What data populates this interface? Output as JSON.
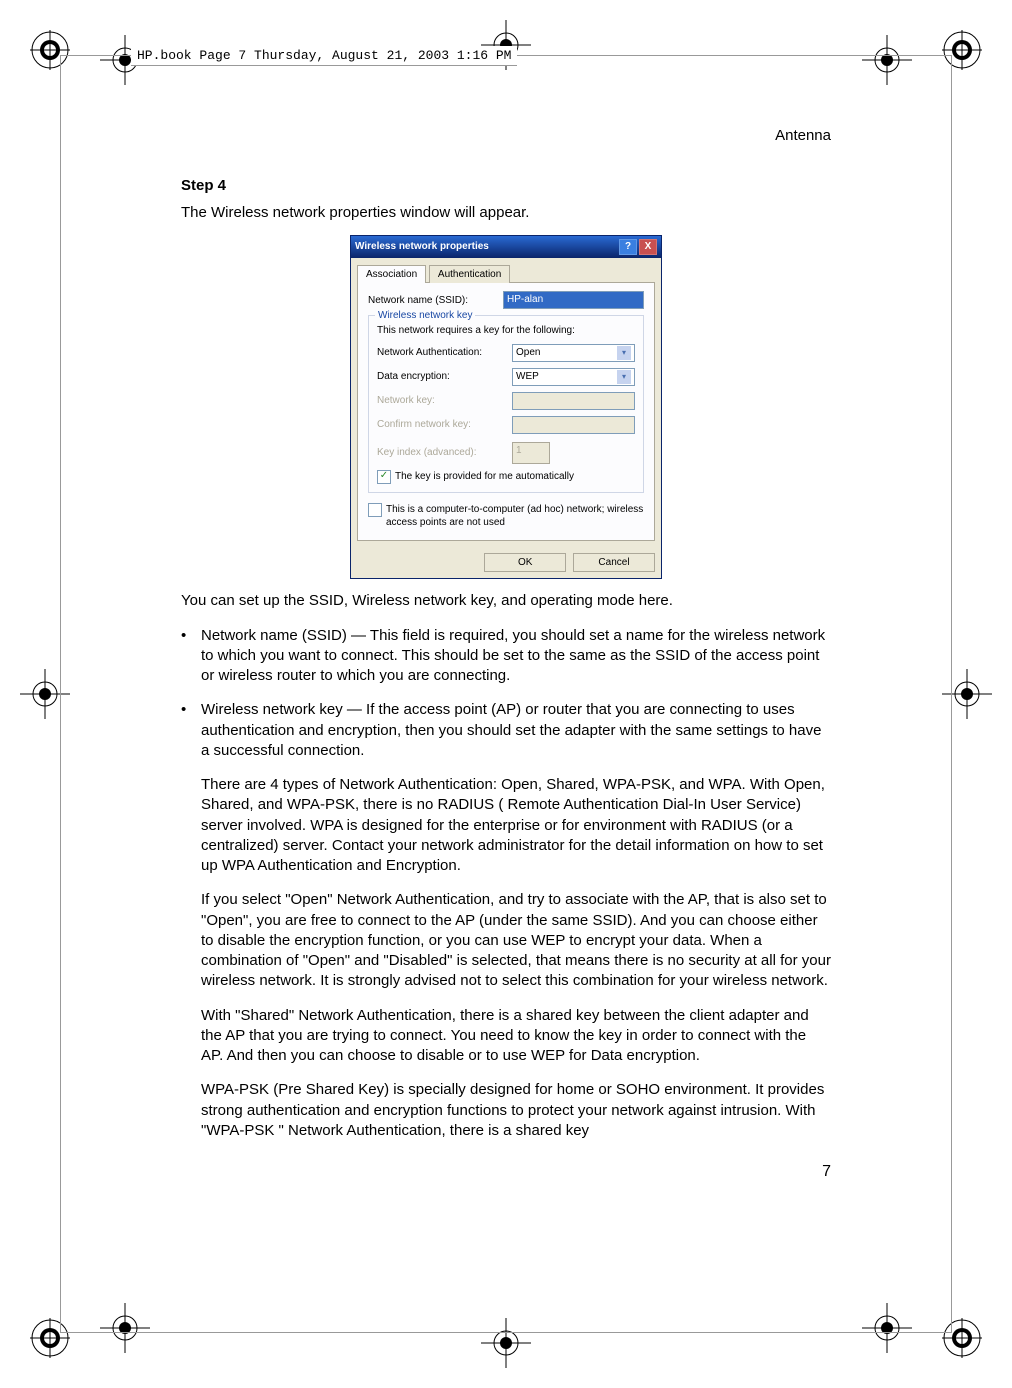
{
  "header_line": "HP.book  Page 7  Thursday, August 21, 2003  1:16 PM",
  "running_head": "Antenna",
  "step_title": "Step 4",
  "intro": "The Wireless network properties window will appear.",
  "dialog": {
    "title": "Wireless network properties",
    "help_btn": "?",
    "close_btn": "X",
    "tab_association": "Association",
    "tab_authentication": "Authentication",
    "ssid_label": "Network name (SSID):",
    "ssid_value": "HP-alan",
    "fieldset_legend": "Wireless network key",
    "fieldset_hint": "This network requires a key for the following:",
    "auth_label": "Network Authentication:",
    "auth_value": "Open",
    "enc_label": "Data encryption:",
    "enc_value": "WEP",
    "key_label": "Network key:",
    "confirm_label": "Confirm network key:",
    "keyindex_label": "Key index (advanced):",
    "keyindex_value": "1",
    "auto_label": "The key is provided for me automatically",
    "adhoc_label": "This is a computer-to-computer (ad hoc) network; wireless access points are not used",
    "ok": "OK",
    "cancel": "Cancel"
  },
  "after_dialog": "You can set up the SSID, Wireless network key, and operating mode here.",
  "bullets": [
    "Network name (SSID) — This field is required, you should set a name for the wireless network to which you want to connect. This should be set to the same as the SSID of the access point or wireless router to which you are connecting.",
    "Wireless network key — If the access point (AP) or router that you are connecting to uses authentication and encryption, then you should set the adapter with the same settings to have a successful connection."
  ],
  "paras": [
    "There are 4 types of Network Authentication: Open, Shared, WPA-PSK, and WPA. With Open, Shared, and WPA-PSK, there is no RADIUS ( Remote Authentication Dial-In User Service) server involved. WPA is designed for the enterprise or for environment with RADIUS (or a centralized) server. Contact your network administrator for the detail information on how to set up WPA Authentication and Encryption.",
    "If you select \"Open\" Network Authentication, and try to associate with the AP, that is also set to \"Open\", you are free to connect to the AP (under the same SSID). And you can choose either to disable the encryption function, or you can use WEP to encrypt your data. When a combination of \"Open\" and \"Disabled\" is selected, that means there is no security at all for your wireless network. It is strongly advised not to select this combination for your wireless network.",
    "With \"Shared\" Network Authentication, there is a shared key between the client adapter and the AP that you are trying to connect. You need to know the key in order to connect with the AP. And then you can choose to disable or to use WEP for Data encryption.",
    "WPA-PSK (Pre Shared Key) is specially designed for home or SOHO environment. It provides strong authentication and encryption functions to protect your network against intrusion. With \"WPA-PSK \" Network Authentication, there is a shared key"
  ],
  "page_number": "7"
}
